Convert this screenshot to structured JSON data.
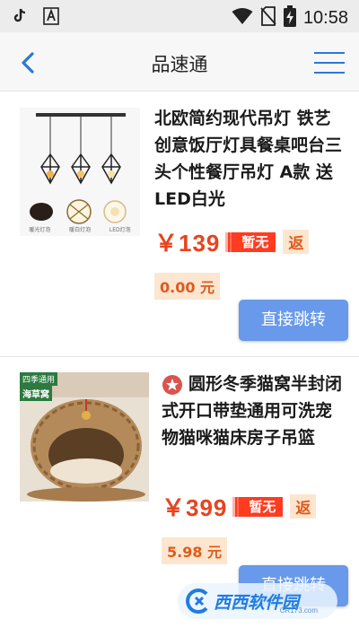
{
  "status_bar": {
    "time": "10:58",
    "icons": [
      "tiktok-icon",
      "font-a-icon",
      "wifi-icon",
      "no-sim-icon",
      "battery-charging-icon"
    ],
    "app_icon_letter": "A"
  },
  "app_bar": {
    "title": "品速通",
    "back_icon": "chevron-left-icon",
    "menu_icon": "hamburger-menu-icon",
    "accent_color": "#2b78d9"
  },
  "products": [
    {
      "title": "北欧简约现代吊灯 铁艺创意饭厅灯具餐桌吧台三头个性餐厅吊灯 A款 送LED白光",
      "price": "￥139",
      "tag": "暂无",
      "rebate_label": "返",
      "rebate_amount": "0.00 元",
      "button_label": "直接跳转",
      "thumb_captions": [
        "暖光灯泡",
        "暖白灯泡",
        "LED灯泡"
      ]
    },
    {
      "title": "圆形冬季猫窝半封闭式开口带垫通用可洗宠物猫咪猫床房子吊篮",
      "price": "￥399",
      "tag": "暂无",
      "rebate_label": "返",
      "rebate_amount": "5.98 元",
      "button_label": "直接跳转",
      "badge_icon": "star-badge-icon",
      "thumb_label_top": "四季通用",
      "thumb_label_bottom": "海草窝"
    }
  ],
  "watermark": {
    "text": "西西软件园",
    "sub": "CR173.com"
  },
  "colors": {
    "price": "#e8431f",
    "tag_bg": "#ff3b20",
    "rebate_bg": "#fde6cf",
    "button_bg": "#6899ea"
  }
}
